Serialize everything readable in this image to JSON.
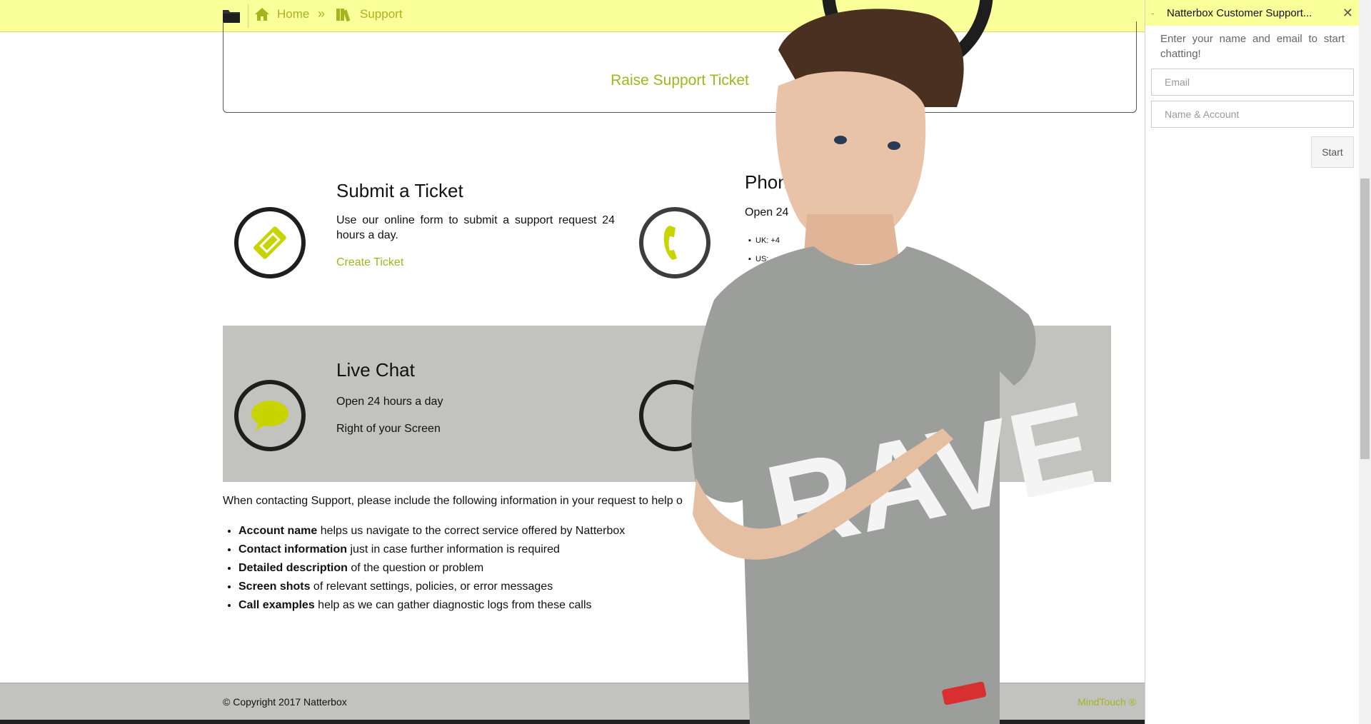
{
  "colors": {
    "accent": "#a4b41f",
    "lime": "#c8d400",
    "topbar": "#fbff99",
    "band": "#c2c3bf"
  },
  "breadcrumb": {
    "icons": [
      "folder-icon",
      "home-icon",
      "books-icon"
    ],
    "home": "Home",
    "separator": "»",
    "support": "Support"
  },
  "raise_ticket": {
    "label": "Raise Support Ticket"
  },
  "features": {
    "submit": {
      "title": "Submit a Ticket",
      "text": "Use our online form to submit a support request 24 hours a day.",
      "link": "Create Ticket",
      "icon": "ticket-icon"
    },
    "phone": {
      "title": "Phon",
      "text": "Open 24",
      "items": [
        "UK: +4",
        "US:"
      ],
      "icon": "phone-icon"
    },
    "chat": {
      "title": "Live Chat",
      "line1": "Open 24 hours a day",
      "line2": "Right of your Screen",
      "icon": "chat-bubble-icon"
    }
  },
  "info": {
    "intro": "When contacting Support, please include the following information in your request to help o",
    "items": [
      {
        "bold": "Account name",
        "text": " helps us navigate to the correct service offered by Natterbox"
      },
      {
        "bold": "Contact information",
        "text": " just in case further information is required"
      },
      {
        "bold": "Detailed description",
        "text": " of the question or problem"
      },
      {
        "bold": "Screen shots",
        "text": " of relevant settings, policies, or error messages"
      },
      {
        "bold": "Call examples",
        "text": " help as we can gather diagnostic logs from these calls"
      }
    ]
  },
  "footer": {
    "copyright": "© Copyright 2017 Natterbox",
    "mindtouch": "MindTouch ®"
  },
  "chat_widget": {
    "title": "Natterbox Customer Support...",
    "minimize": "-",
    "close": "✕",
    "intro": "Enter your name and email to start chatting!",
    "email_placeholder": "Email",
    "name_placeholder": "Name & Account",
    "start": "Start"
  },
  "overlay": {
    "shirt_text": "RAVE"
  }
}
